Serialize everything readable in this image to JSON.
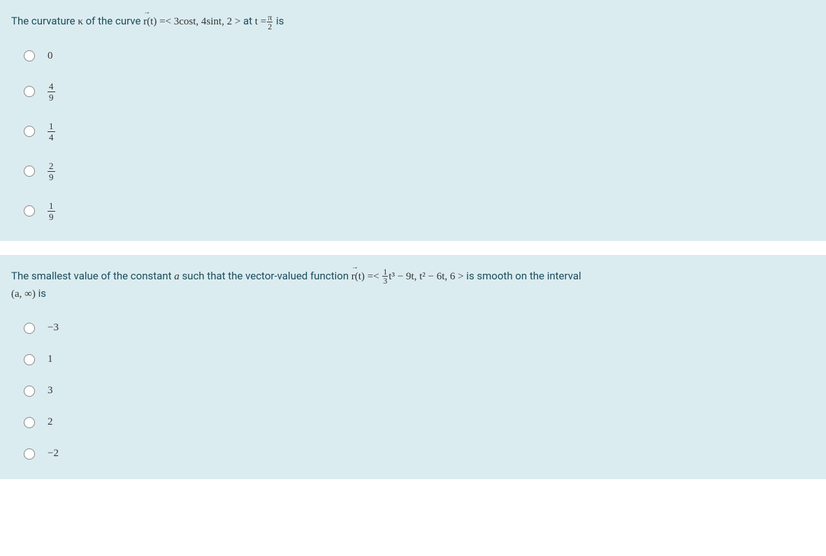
{
  "q1": {
    "text_prefix": "The curvature ",
    "kappa": "κ",
    "text_mid1": " of the curve ",
    "vec": "r",
    "fn": "(t) =< 3cost, 4sint, 2 >",
    "text_mid2": " at ",
    "at": "t =",
    "frac_num": "π",
    "frac_den": "2",
    "text_suffix": " is",
    "options": [
      {
        "type": "plain",
        "value": "0"
      },
      {
        "type": "frac",
        "num": "4",
        "den": "9"
      },
      {
        "type": "frac",
        "num": "1",
        "den": "4"
      },
      {
        "type": "frac",
        "num": "2",
        "den": "9"
      },
      {
        "type": "frac",
        "num": "1",
        "den": "9"
      }
    ]
  },
  "q2": {
    "text_prefix": "The smallest value of the constant ",
    "a": "a",
    "text_mid1": " such that the vector-valued function ",
    "vec": "r",
    "fn_part1": "(t) =< ",
    "frac_num": "1",
    "frac_den": "3",
    "fn_part2": "t³ − 9t, t² − 6t, 6 >",
    "text_mid2": " is smooth on the interval ",
    "interval": "(a, ∞)",
    "text_suffix": " is",
    "options": [
      {
        "type": "plain",
        "value": "−3"
      },
      {
        "type": "plain",
        "value": "1"
      },
      {
        "type": "plain",
        "value": "3"
      },
      {
        "type": "plain",
        "value": "2"
      },
      {
        "type": "plain",
        "value": "−2"
      }
    ]
  }
}
